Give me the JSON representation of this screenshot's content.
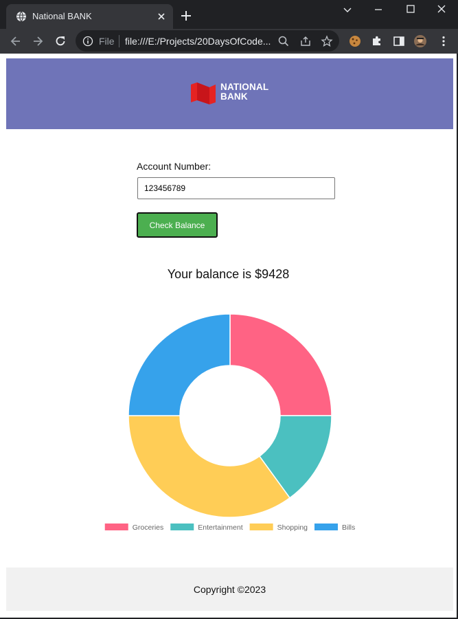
{
  "browser": {
    "tab_title": "National BANK",
    "omnibox_scheme": "File",
    "url": "file:///E:/Projects/20DaysOfCode..."
  },
  "header": {
    "logo_line1": "NATIONAL",
    "logo_line2": "BANK",
    "logo_color": "#e52322",
    "background": "#6f74b8"
  },
  "form": {
    "account_label": "Account Number:",
    "account_value": "123456789",
    "check_button": "Check Balance",
    "button_color": "#4caf50"
  },
  "balance_text": "Your balance is $9428",
  "chart_data": {
    "type": "pie",
    "variant": "doughnut",
    "categories": [
      "Groceries",
      "Entertainment",
      "Shopping",
      "Bills"
    ],
    "values": [
      25,
      15,
      35,
      25
    ],
    "colors": [
      "#ff6384",
      "#4bc0c0",
      "#ffcd56",
      "#36a2eb"
    ],
    "legend": "bottom"
  },
  "footer": {
    "copyright": "Copyright ©2023"
  }
}
